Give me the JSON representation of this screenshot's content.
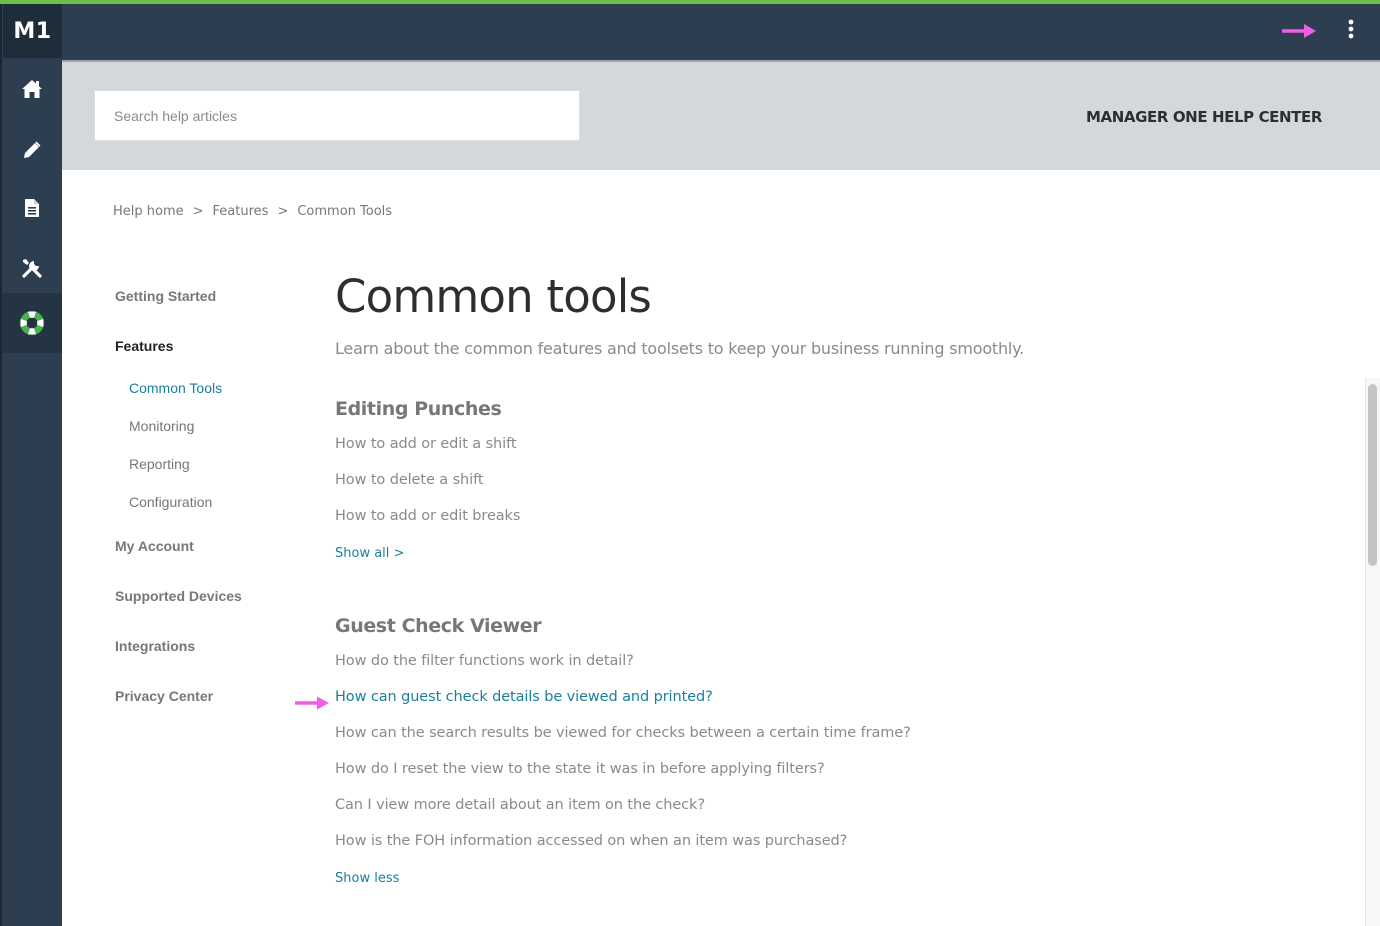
{
  "app": {
    "logo": "M1"
  },
  "topbar": {
    "menu_icon": "more-vertical-icon",
    "annotation_arrow_color": "#f05ee8"
  },
  "sidebar": {
    "items": [
      {
        "icon": "home-icon",
        "label": "Home"
      },
      {
        "icon": "pencil-icon",
        "label": "Edit"
      },
      {
        "icon": "document-icon",
        "label": "Documents"
      },
      {
        "icon": "tools-icon",
        "label": "Tools"
      },
      {
        "icon": "lifebuoy-icon",
        "label": "Help",
        "active": true
      }
    ]
  },
  "search": {
    "placeholder": "Search help articles",
    "value": ""
  },
  "header": {
    "title": "MANAGER ONE HELP CENTER"
  },
  "breadcrumb": {
    "items": [
      "Help home",
      "Features",
      "Common Tools"
    ],
    "separator": ">"
  },
  "leftnav": {
    "getting_started": "Getting Started",
    "features": "Features",
    "features_sub": [
      "Common Tools",
      "Monitoring",
      "Reporting",
      "Configuration"
    ],
    "my_account": "My Account",
    "supported_devices": "Supported Devices",
    "integrations": "Integrations",
    "privacy_center": "Privacy Center"
  },
  "main": {
    "title": "Common tools",
    "description": "Learn about the common features and toolsets to keep your business running smoothly.",
    "sections": [
      {
        "title": "Editing Punches",
        "articles": [
          "How to add or edit a shift",
          "How to delete a shift",
          "How to add or edit breaks"
        ],
        "toggle": "Show all >"
      },
      {
        "title": "Guest Check Viewer",
        "articles": [
          "How do the filter functions work in detail?",
          "How can guest check details be viewed and printed?",
          "How can the search results be viewed for checks between a certain time frame?",
          "How do I reset the view to the state it was in before applying filters?",
          "Can I view more detail about an item on the check?",
          "How is the FOH information accessed on when an item was purchased?"
        ],
        "toggle": "Show less"
      }
    ]
  },
  "colors": {
    "accent_green": "#6cc04a",
    "topbar": "#2c3e50",
    "link": "#1a7f9c",
    "muted_text": "#8a8a8a",
    "band": "#d5d8db",
    "lifebuoy_green": "#4caf50"
  }
}
